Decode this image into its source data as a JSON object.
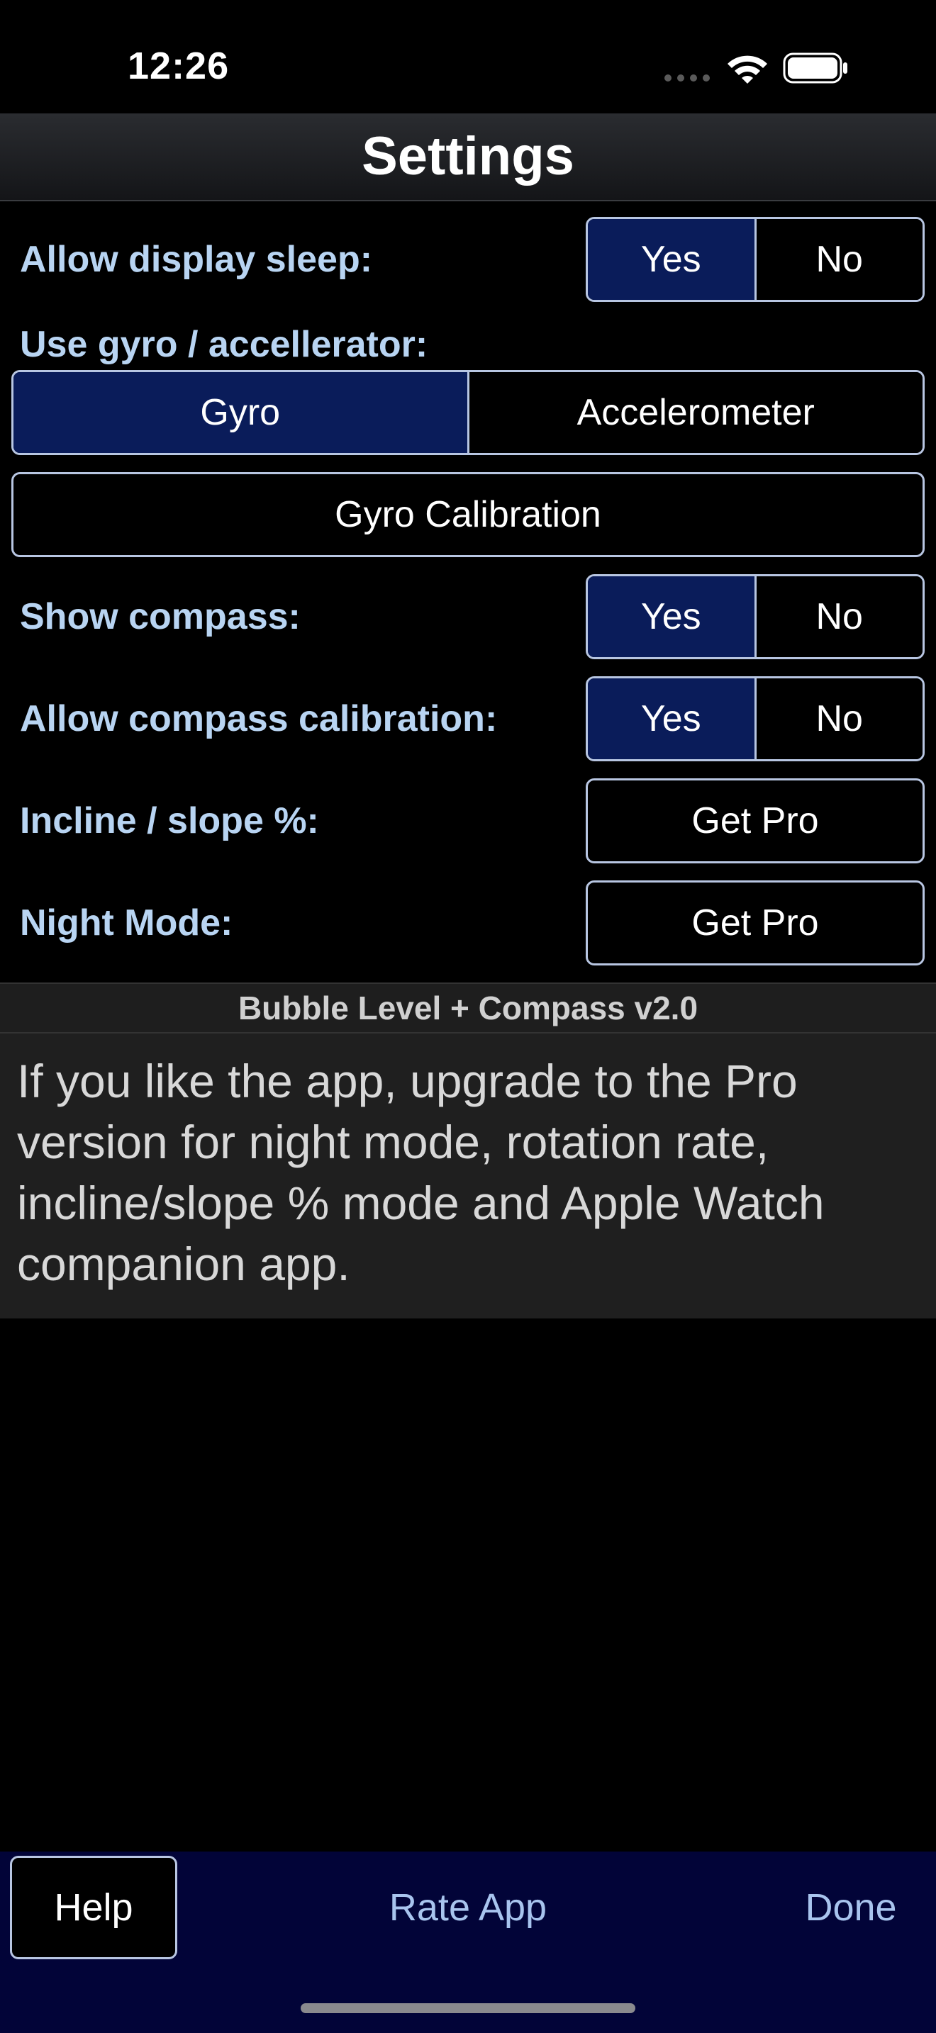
{
  "status_bar": {
    "time": "12:26",
    "icons": [
      "cellular-dots-icon",
      "wifi-icon",
      "battery-icon"
    ]
  },
  "nav": {
    "title": "Settings"
  },
  "settings": {
    "display_sleep": {
      "label": "Allow display sleep:",
      "options": [
        "Yes",
        "No"
      ],
      "selected": "Yes"
    },
    "sensor": {
      "label": "Use gyro / accellerator:",
      "options": [
        "Gyro",
        "Accelerometer"
      ],
      "selected": "Gyro"
    },
    "gyro_calibration": {
      "label": "Gyro Calibration"
    },
    "show_compass": {
      "label": "Show compass:",
      "options": [
        "Yes",
        "No"
      ],
      "selected": "Yes"
    },
    "compass_calibration": {
      "label": "Allow compass calibration:",
      "options": [
        "Yes",
        "No"
      ],
      "selected": "Yes"
    },
    "incline_slope": {
      "label": "Incline / slope %:",
      "button": "Get Pro"
    },
    "night_mode": {
      "label": "Night Mode:",
      "button": "Get Pro"
    }
  },
  "version": "Bubble Level + Compass v2.0",
  "promo_text": "If you like the app, upgrade to the Pro version for night mode, rotation rate, incline/slope % mode and Apple Watch companion app.",
  "bottom_bar": {
    "help": "Help",
    "rate": "Rate App",
    "done": "Done"
  },
  "colors": {
    "accent_label": "#b8d4f2",
    "selected_segment": "#0a1c5a",
    "bottom_bar": "#020438",
    "link": "#a8c4ee"
  }
}
